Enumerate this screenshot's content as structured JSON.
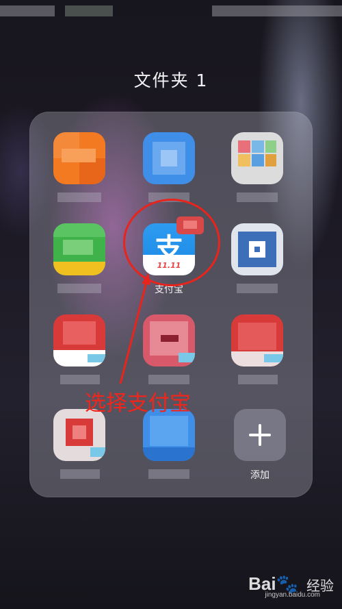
{
  "folder": {
    "title": "文件夹 1"
  },
  "apps": [
    {
      "name": "blurred-app-1",
      "label": "",
      "icon": "pixelated-orange-icon",
      "color": "#f47a22"
    },
    {
      "name": "blurred-app-2",
      "label": "",
      "icon": "pixelated-blue-icon",
      "color": "#3f8ee8"
    },
    {
      "name": "blurred-app-3",
      "label": "",
      "icon": "pixelated-multicolor-icon",
      "color": "#d8d8d8"
    },
    {
      "name": "blurred-app-4",
      "label": "",
      "icon": "pixelated-green-icon",
      "color": "#3fb24a"
    },
    {
      "name": "alipay-app",
      "label": "支付宝",
      "icon": "alipay-icon",
      "color": "#1a86e3",
      "icon_char": "支",
      "icon_band": "11.11"
    },
    {
      "name": "blurred-app-6",
      "label": "",
      "icon": "pixelated-blue-white-icon",
      "color": "#3c6fb8"
    },
    {
      "name": "blurred-app-7",
      "label": "",
      "icon": "pixelated-red-icon",
      "color": "#d83a3a"
    },
    {
      "name": "blurred-app-8",
      "label": "",
      "icon": "pixelated-pink-icon",
      "color": "#d85a6a"
    },
    {
      "name": "blurred-app-9",
      "label": "",
      "icon": "pixelated-red-icon",
      "color": "#d83a3a"
    },
    {
      "name": "blurred-app-10",
      "label": "",
      "icon": "pixelated-red-white-icon",
      "color": "#d8d0d0"
    },
    {
      "name": "blurred-app-11",
      "label": "",
      "icon": "pixelated-blue-icon",
      "color": "#3f8ee8"
    },
    {
      "name": "add-app",
      "label": "添加",
      "icon": "plus-icon",
      "color": "#9a9aaa"
    }
  ],
  "annotation": {
    "text": "选择支付宝",
    "color": "#e8241c"
  },
  "watermark": {
    "brand": "Bai",
    "brand_suffix": "经验",
    "url": "jingyan.baidu.com"
  }
}
